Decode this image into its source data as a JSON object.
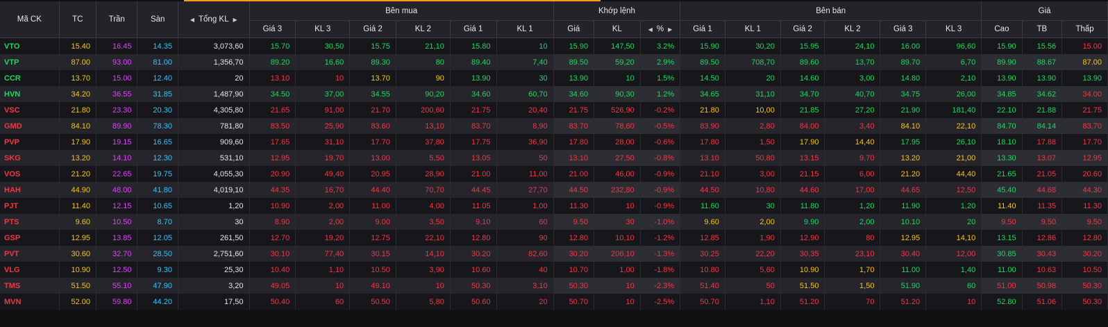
{
  "header": {
    "ma_ck": "Mã CK",
    "tc": "TC",
    "tran": "Trần",
    "san": "Sàn",
    "tong_kl": "Tổng KL",
    "ben_mua": "Bên mua",
    "khop_lenh": "Khớp lệnh",
    "ben_ban": "Bên bán",
    "gia": "Giá",
    "gia3": "Giá 3",
    "kl3": "KL 3",
    "gia2": "Giá 2",
    "kl2": "KL 2",
    "gia1": "Giá 1",
    "kl1": "KL 1",
    "khop_gia": "Giá",
    "khop_kl": "KL",
    "pct": "%",
    "cao": "Cao",
    "tb": "TB",
    "thap": "Thấp"
  },
  "colors": {
    "up": "#1ed760",
    "down": "#f23645",
    "ref": "#f5c518",
    "ceiling": "#e040fb",
    "floor": "#34c3ff"
  },
  "rows": [
    {
      "sym": "VTO",
      "s": "u",
      "tc": "15.40",
      "tran": "16.45",
      "san": "14.35",
      "tkl": "3,073,60",
      "b3": "15.70",
      "b3c": "u",
      "bk3": "30,50",
      "b2": "15.75",
      "b2c": "u",
      "bk2": "21,10",
      "b1": "15.80",
      "b1c": "u",
      "bk1": "10",
      "mp": "15.90",
      "mc": "u",
      "mk": "147,50",
      "pct": "3.2%",
      "s1": "15.90",
      "s1c": "u",
      "sk1": "30,20",
      "s2": "15.95",
      "s2c": "u",
      "sk2": "24,10",
      "s3": "16.00",
      "s3c": "u",
      "sk3": "96,60",
      "cao": "15.90",
      "caoc": "u",
      "tb": "15.56",
      "tbc": "u",
      "thap": "15.00",
      "thapc": "d"
    },
    {
      "sym": "VTP",
      "s": "u",
      "tc": "87.00",
      "tran": "93.00",
      "san": "81.00",
      "tkl": "1,356,70",
      "b3": "89.20",
      "b3c": "u",
      "bk3": "16,60",
      "b2": "89.30",
      "b2c": "u",
      "bk2": "80",
      "b1": "89.40",
      "b1c": "u",
      "bk1": "7,40",
      "mp": "89.50",
      "mc": "u",
      "mk": "59,20",
      "pct": "2.9%",
      "s1": "89.50",
      "s1c": "u",
      "sk1": "708,70",
      "s2": "89.60",
      "s2c": "u",
      "sk2": "13,70",
      "s3": "89.70",
      "s3c": "u",
      "sk3": "6,70",
      "cao": "89.90",
      "caoc": "u",
      "tb": "88.67",
      "tbc": "u",
      "thap": "87.00",
      "thapc": "r"
    },
    {
      "sym": "CCR",
      "s": "u",
      "tc": "13.70",
      "tran": "15.00",
      "san": "12.40",
      "tkl": "20",
      "b3": "13.10",
      "b3c": "d",
      "bk3": "10",
      "b2": "13.70",
      "b2c": "r",
      "bk2": "90",
      "b1": "13.90",
      "b1c": "u",
      "bk1": "30",
      "mp": "13.90",
      "mc": "u",
      "mk": "10",
      "pct": "1.5%",
      "s1": "14.50",
      "s1c": "u",
      "sk1": "20",
      "s2": "14.60",
      "s2c": "u",
      "sk2": "3,00",
      "s3": "14.80",
      "s3c": "u",
      "sk3": "2,10",
      "cao": "13.90",
      "caoc": "u",
      "tb": "13.90",
      "tbc": "u",
      "thap": "13.90",
      "thapc": "u"
    },
    {
      "sym": "HVN",
      "s": "u",
      "tc": "34.20",
      "tran": "36.55",
      "san": "31.85",
      "tkl": "1,487,90",
      "b3": "34.50",
      "b3c": "u",
      "bk3": "37,00",
      "b2": "34.55",
      "b2c": "u",
      "bk2": "90,20",
      "b1": "34.60",
      "b1c": "u",
      "bk1": "60,70",
      "mp": "34.60",
      "mc": "u",
      "mk": "90,30",
      "pct": "1.2%",
      "s1": "34.65",
      "s1c": "u",
      "sk1": "31,10",
      "s2": "34.70",
      "s2c": "u",
      "sk2": "40,70",
      "s3": "34.75",
      "s3c": "u",
      "sk3": "26,00",
      "cao": "34.85",
      "caoc": "u",
      "tb": "34.62",
      "tbc": "u",
      "thap": "34.00",
      "thapc": "d"
    },
    {
      "sym": "VSC",
      "s": "d",
      "tc": "21.80",
      "tran": "23.30",
      "san": "20.30",
      "tkl": "4,305,80",
      "b3": "21.65",
      "b3c": "d",
      "bk3": "91,00",
      "b2": "21.70",
      "b2c": "d",
      "bk2": "200,60",
      "b1": "21.75",
      "b1c": "d",
      "bk1": "20,40",
      "mp": "21.75",
      "mc": "d",
      "mk": "526,90",
      "pct": "-0.2%",
      "s1": "21.80",
      "s1c": "r",
      "sk1": "10,00",
      "s2": "21.85",
      "s2c": "u",
      "sk2": "27,20",
      "s3": "21.90",
      "s3c": "u",
      "sk3": "181,40",
      "cao": "22.10",
      "caoc": "u",
      "tb": "21.88",
      "tbc": "u",
      "thap": "21.75",
      "thapc": "d"
    },
    {
      "sym": "GMD",
      "s": "d",
      "tc": "84.10",
      "tran": "89.90",
      "san": "78.30",
      "tkl": "781,80",
      "b3": "83.50",
      "b3c": "d",
      "bk3": "25,90",
      "b2": "83.60",
      "b2c": "d",
      "bk2": "13,10",
      "b1": "83.70",
      "b1c": "d",
      "bk1": "8,90",
      "mp": "83.70",
      "mc": "d",
      "mk": "78,60",
      "pct": "-0.5%",
      "s1": "83.90",
      "s1c": "d",
      "sk1": "2,80",
      "s2": "84.00",
      "s2c": "d",
      "sk2": "3,40",
      "s3": "84.10",
      "s3c": "r",
      "sk3": "22,10",
      "cao": "84.70",
      "caoc": "u",
      "tb": "84.14",
      "tbc": "u",
      "thap": "83.70",
      "thapc": "d"
    },
    {
      "sym": "PVP",
      "s": "d",
      "tc": "17.90",
      "tran": "19.15",
      "san": "16.65",
      "tkl": "909,60",
      "b3": "17.65",
      "b3c": "d",
      "bk3": "31,10",
      "b2": "17.70",
      "b2c": "d",
      "bk2": "37,80",
      "b1": "17.75",
      "b1c": "d",
      "bk1": "36,90",
      "mp": "17.80",
      "mc": "d",
      "mk": "28,00",
      "pct": "-0.6%",
      "s1": "17.80",
      "s1c": "d",
      "sk1": "1,50",
      "s2": "17.90",
      "s2c": "r",
      "sk2": "14,40",
      "s3": "17.95",
      "s3c": "u",
      "sk3": "26,10",
      "cao": "18.10",
      "caoc": "u",
      "tb": "17.88",
      "tbc": "d",
      "thap": "17.70",
      "thapc": "d"
    },
    {
      "sym": "SKG",
      "s": "d",
      "tc": "13.20",
      "tran": "14.10",
      "san": "12.30",
      "tkl": "531,10",
      "b3": "12.95",
      "b3c": "d",
      "bk3": "19,70",
      "b2": "13.00",
      "b2c": "d",
      "bk2": "5,50",
      "b1": "13.05",
      "b1c": "d",
      "bk1": "50",
      "mp": "13.10",
      "mc": "d",
      "mk": "27,50",
      "pct": "-0.8%",
      "s1": "13.10",
      "s1c": "d",
      "sk1": "50,80",
      "s2": "13.15",
      "s2c": "d",
      "sk2": "9,70",
      "s3": "13.20",
      "s3c": "r",
      "sk3": "21,00",
      "cao": "13.30",
      "caoc": "u",
      "tb": "13.07",
      "tbc": "d",
      "thap": "12.95",
      "thapc": "d"
    },
    {
      "sym": "VOS",
      "s": "d",
      "tc": "21.20",
      "tran": "22.65",
      "san": "19.75",
      "tkl": "4,055,30",
      "b3": "20.90",
      "b3c": "d",
      "bk3": "49,40",
      "b2": "20.95",
      "b2c": "d",
      "bk2": "28,90",
      "b1": "21.00",
      "b1c": "d",
      "bk1": "11,00",
      "mp": "21.00",
      "mc": "d",
      "mk": "46,00",
      "pct": "-0.9%",
      "s1": "21.10",
      "s1c": "d",
      "sk1": "3,00",
      "s2": "21.15",
      "s2c": "d",
      "sk2": "6,00",
      "s3": "21.20",
      "s3c": "r",
      "sk3": "44,40",
      "cao": "21.65",
      "caoc": "u",
      "tb": "21.05",
      "tbc": "d",
      "thap": "20.60",
      "thapc": "d"
    },
    {
      "sym": "HAH",
      "s": "d",
      "tc": "44.90",
      "tran": "48.00",
      "san": "41.80",
      "tkl": "4,019,10",
      "b3": "44.35",
      "b3c": "d",
      "bk3": "16,70",
      "b2": "44.40",
      "b2c": "d",
      "bk2": "70,70",
      "b1": "44.45",
      "b1c": "d",
      "bk1": "27,70",
      "mp": "44.50",
      "mc": "d",
      "mk": "232,80",
      "pct": "-0.9%",
      "s1": "44.50",
      "s1c": "d",
      "sk1": "10,80",
      "s2": "44.60",
      "s2c": "d",
      "sk2": "17,00",
      "s3": "44.65",
      "s3c": "d",
      "sk3": "12,50",
      "cao": "45.40",
      "caoc": "u",
      "tb": "44.68",
      "tbc": "d",
      "thap": "44.30",
      "thapc": "d"
    },
    {
      "sym": "PJT",
      "s": "d",
      "tc": "11.40",
      "tran": "12.15",
      "san": "10.65",
      "tkl": "1,20",
      "b3": "10.90",
      "b3c": "d",
      "bk3": "2,00",
      "b2": "11.00",
      "b2c": "d",
      "bk2": "4,00",
      "b1": "11.05",
      "b1c": "d",
      "bk1": "1,00",
      "mp": "11.30",
      "mc": "d",
      "mk": "10",
      "pct": "-0.9%",
      "s1": "11.60",
      "s1c": "u",
      "sk1": "30",
      "s2": "11.80",
      "s2c": "u",
      "sk2": "1,20",
      "s3": "11.90",
      "s3c": "u",
      "sk3": "1,20",
      "cao": "11.40",
      "caoc": "r",
      "tb": "11.35",
      "tbc": "d",
      "thap": "11.30",
      "thapc": "d"
    },
    {
      "sym": "PTS",
      "s": "d",
      "tc": "9.60",
      "tran": "10.50",
      "san": "8.70",
      "tkl": "30",
      "b3": "8.90",
      "b3c": "d",
      "bk3": "2,00",
      "b2": "9.00",
      "b2c": "d",
      "bk2": "3,50",
      "b1": "9.10",
      "b1c": "d",
      "bk1": "60",
      "mp": "9.50",
      "mc": "d",
      "mk": "30",
      "pct": "-1.0%",
      "s1": "9.60",
      "s1c": "r",
      "sk1": "2,00",
      "s2": "9.90",
      "s2c": "u",
      "sk2": "2,00",
      "s3": "10.10",
      "s3c": "u",
      "sk3": "20",
      "cao": "9.50",
      "caoc": "d",
      "tb": "9.50",
      "tbc": "d",
      "thap": "9.50",
      "thapc": "d"
    },
    {
      "sym": "GSP",
      "s": "d",
      "tc": "12.95",
      "tran": "13.85",
      "san": "12.05",
      "tkl": "261,50",
      "b3": "12.70",
      "b3c": "d",
      "bk3": "19,20",
      "b2": "12.75",
      "b2c": "d",
      "bk2": "22,10",
      "b1": "12.80",
      "b1c": "d",
      "bk1": "90",
      "mp": "12.80",
      "mc": "d",
      "mk": "10,10",
      "pct": "-1.2%",
      "s1": "12.85",
      "s1c": "d",
      "sk1": "1,90",
      "s2": "12.90",
      "s2c": "d",
      "sk2": "80",
      "s3": "12.95",
      "s3c": "r",
      "sk3": "14,10",
      "cao": "13.15",
      "caoc": "u",
      "tb": "12.86",
      "tbc": "d",
      "thap": "12.80",
      "thapc": "d"
    },
    {
      "sym": "PVT",
      "s": "d",
      "tc": "30.60",
      "tran": "32.70",
      "san": "28.50",
      "tkl": "2,751,60",
      "b3": "30.10",
      "b3c": "d",
      "bk3": "77,40",
      "b2": "30.15",
      "b2c": "d",
      "bk2": "14,10",
      "b1": "30.20",
      "b1c": "d",
      "bk1": "82,60",
      "mp": "30.20",
      "mc": "d",
      "mk": "206,10",
      "pct": "-1.3%",
      "s1": "30.25",
      "s1c": "d",
      "sk1": "22,20",
      "s2": "30.35",
      "s2c": "d",
      "sk2": "23,10",
      "s3": "30.40",
      "s3c": "d",
      "sk3": "12,00",
      "cao": "30.85",
      "caoc": "u",
      "tb": "30.43",
      "tbc": "d",
      "thap": "30.20",
      "thapc": "d"
    },
    {
      "sym": "VLG",
      "s": "d",
      "tc": "10.90",
      "tran": "12.50",
      "san": "9.30",
      "tkl": "25,30",
      "b3": "10.40",
      "b3c": "d",
      "bk3": "1,10",
      "b2": "10.50",
      "b2c": "d",
      "bk2": "3,90",
      "b1": "10.60",
      "b1c": "d",
      "bk1": "40",
      "mp": "10.70",
      "mc": "d",
      "mk": "1,00",
      "pct": "-1.8%",
      "s1": "10.80",
      "s1c": "d",
      "sk1": "5,60",
      "s2": "10.90",
      "s2c": "r",
      "sk2": "1,70",
      "s3": "11.00",
      "s3c": "u",
      "sk3": "1,40",
      "cao": "11.00",
      "caoc": "u",
      "tb": "10.63",
      "tbc": "d",
      "thap": "10.50",
      "thapc": "d"
    },
    {
      "sym": "TMS",
      "s": "d",
      "tc": "51.50",
      "tran": "55.10",
      "san": "47.90",
      "tkl": "3,20",
      "b3": "49.05",
      "b3c": "d",
      "bk3": "10",
      "b2": "49.10",
      "b2c": "d",
      "bk2": "10",
      "b1": "50.30",
      "b1c": "d",
      "bk1": "3,10",
      "mp": "50.30",
      "mc": "d",
      "mk": "10",
      "pct": "-2.3%",
      "s1": "51.40",
      "s1c": "d",
      "sk1": "50",
      "s2": "51.50",
      "s2c": "r",
      "sk2": "1,50",
      "s3": "51.90",
      "s3c": "u",
      "sk3": "60",
      "cao": "51.00",
      "caoc": "d",
      "tb": "50.98",
      "tbc": "d",
      "thap": "50.30",
      "thapc": "d"
    },
    {
      "sym": "MVN",
      "s": "d",
      "tc": "52.00",
      "tran": "59.80",
      "san": "44.20",
      "tkl": "17,50",
      "b3": "50.40",
      "b3c": "d",
      "bk3": "60",
      "b2": "50.50",
      "b2c": "d",
      "bk2": "5,80",
      "b1": "50.60",
      "b1c": "d",
      "bk1": "20",
      "mp": "50.70",
      "mc": "d",
      "mk": "10",
      "pct": "-2.5%",
      "s1": "50.70",
      "s1c": "d",
      "sk1": "1,10",
      "s2": "51.20",
      "s2c": "d",
      "sk2": "70",
      "s3": "51.20",
      "s3c": "d",
      "sk3": "10",
      "cao": "52.80",
      "caoc": "u",
      "tb": "51.06",
      "tbc": "d",
      "thap": "50.30",
      "thapc": "d"
    }
  ]
}
